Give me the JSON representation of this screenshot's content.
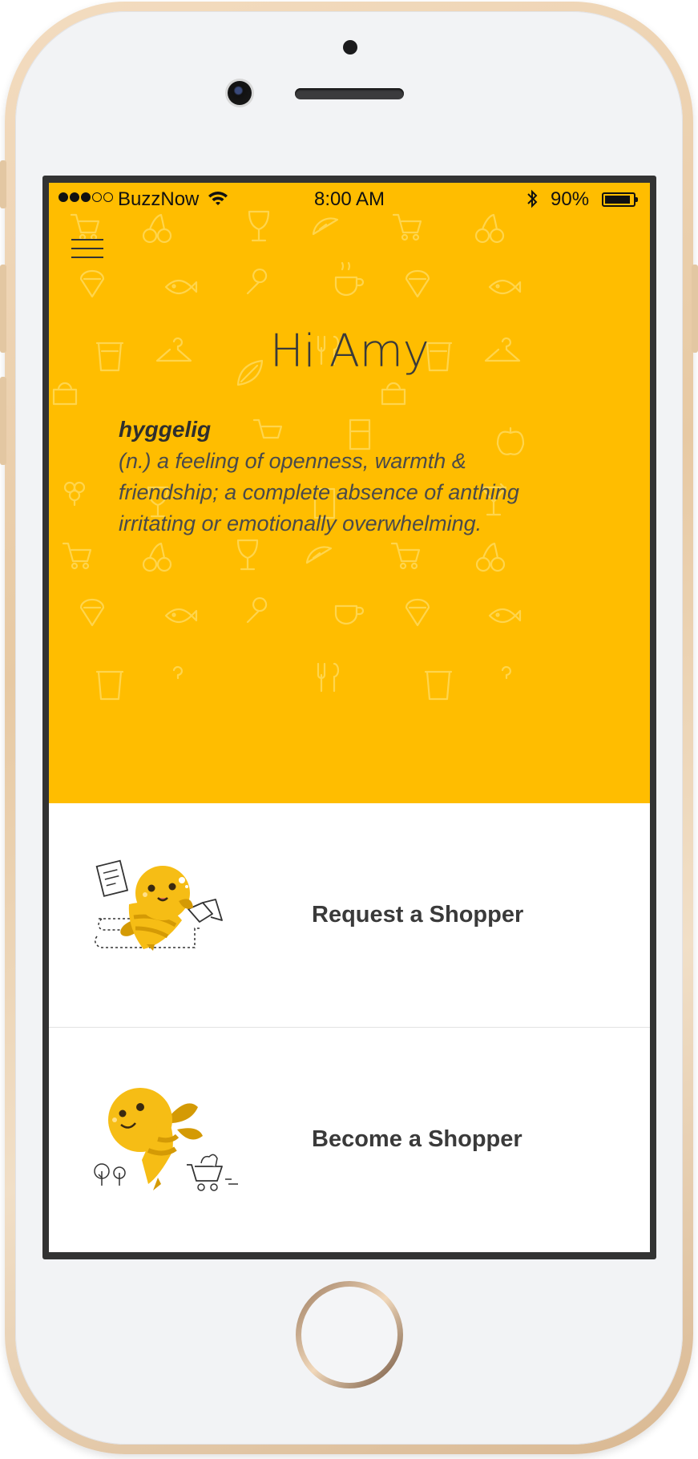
{
  "device": {
    "model": "iPhone"
  },
  "status_bar": {
    "carrier": "BuzzNow",
    "time": "8:00 AM",
    "battery": "90%",
    "battery_level": 0.9,
    "signal_bars_filled": 3,
    "signal_bars_total": 5
  },
  "header": {
    "menu_icon": "hamburger-menu-icon",
    "greeting": "Hi Amy"
  },
  "definition": {
    "word": "hyggelig",
    "meaning_lines": [
      "(n.) a feeling of openness, warmth &",
      "friendship; a complete absence of anthing",
      "irritating or emotionally overwhelming."
    ]
  },
  "options": {
    "request": {
      "label": "Request a Shopper",
      "icon": "bee-with-list-and-megaphone-illustration"
    },
    "become": {
      "label": "Become a Shopper",
      "icon": "bee-with-shopping-cart-illustration"
    }
  },
  "colors": {
    "hero_yellow": "#ffbd00",
    "bee_yellow": "#f6bd15",
    "bee_stripe": "#d49a05",
    "text_dark": "#3a3a3a"
  }
}
